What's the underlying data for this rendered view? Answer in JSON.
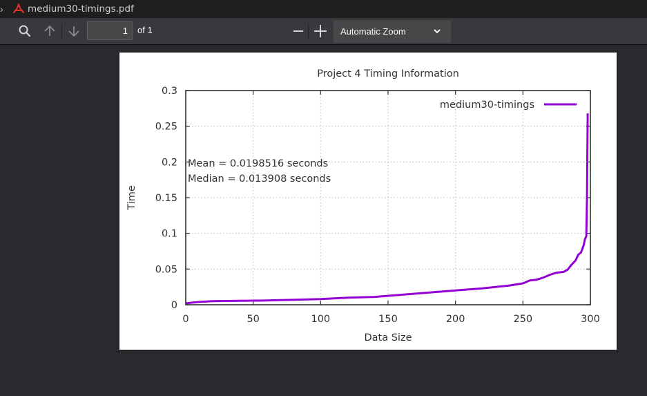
{
  "tab": {
    "title": "medium30-timings.pdf",
    "chevron_icon": "chevron-right-icon",
    "file_icon": "pdf-icon"
  },
  "toolbar": {
    "search_icon": "search-icon",
    "prev_icon": "arrow-up-icon",
    "next_icon": "arrow-down-icon",
    "page_number": "1",
    "page_count_label": "of 1",
    "zoom_out_icon": "minus-icon",
    "zoom_in_icon": "plus-icon",
    "zoom_value": "Automatic Zoom"
  },
  "colors": {
    "series": "#9400d3",
    "tab_bg": "#1e1e1e",
    "toolbar_bg": "#38383d",
    "viewer_bg": "#2a2a2e",
    "pdf_icon": "#e0312a"
  },
  "chart_data": {
    "type": "line",
    "title": "Project 4 Timing Information",
    "xlabel": "Data Size",
    "ylabel": "Time",
    "xlim": [
      0,
      300
    ],
    "ylim": [
      0,
      0.3
    ],
    "xticks": [
      "0",
      "50",
      "100",
      "150",
      "200",
      "250",
      "300"
    ],
    "yticks": [
      "0",
      "0.05",
      "0.1",
      "0.15",
      "0.2",
      "0.25",
      "0.3"
    ],
    "grid": true,
    "legend_position": "top-right",
    "annotations": [
      "Mean = 0.0198516 seconds",
      "Median = 0.013908 seconds"
    ],
    "series": [
      {
        "name": "medium30-timings",
        "x": [
          0,
          10,
          20,
          40,
          60,
          80,
          100,
          110,
          120,
          140,
          160,
          180,
          200,
          220,
          240,
          250,
          255,
          260,
          265,
          270,
          275,
          280,
          283,
          286,
          289,
          291,
          293,
          295,
          296,
          297,
          297.5,
          298
        ],
        "y": [
          0.002,
          0.004,
          0.005,
          0.0055,
          0.006,
          0.007,
          0.008,
          0.009,
          0.01,
          0.011,
          0.014,
          0.017,
          0.02,
          0.023,
          0.027,
          0.03,
          0.034,
          0.035,
          0.038,
          0.042,
          0.045,
          0.046,
          0.049,
          0.056,
          0.062,
          0.07,
          0.073,
          0.083,
          0.092,
          0.096,
          0.15,
          0.268
        ]
      }
    ]
  }
}
